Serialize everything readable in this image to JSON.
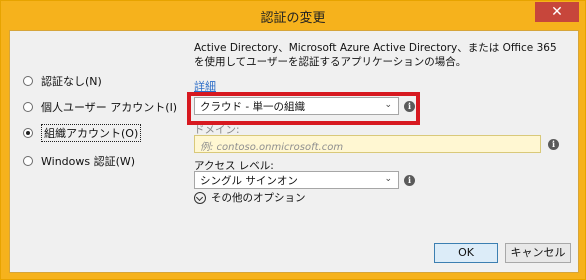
{
  "window": {
    "title": "認証の変更",
    "close_glyph": "✕"
  },
  "auth_options": {
    "items": [
      {
        "label": "認証なし(N)",
        "checked": false
      },
      {
        "label": "個人ユーザー アカウント(I)",
        "checked": false
      },
      {
        "label": "組織アカウント(O)",
        "checked": true
      },
      {
        "label": "Windows 認証(W)",
        "checked": false
      }
    ]
  },
  "main": {
    "description": "Active Directory、Microsoft Azure Active Directory、または Office 365 を使用してユーザーを認証するアプリケーションの場合。",
    "details_link": "詳細",
    "org_type": {
      "value": "クラウド - 単一の組織"
    },
    "domain": {
      "label": "ドメイン:",
      "placeholder": "例: contoso.onmicrosoft.com"
    },
    "access_level": {
      "label": "アクセス レベル:",
      "value": "シングル サインオン"
    },
    "more_options": "その他のオプション"
  },
  "buttons": {
    "ok": "OK",
    "cancel": "キャンセル"
  },
  "icons": {
    "info": "i",
    "chevron": "⌄"
  },
  "colors": {
    "title_bar": "#f6b21c",
    "close": "#c7463b",
    "highlight": "#d71920",
    "link": "#2f6fc8",
    "input_bg": "#fff7d2"
  }
}
